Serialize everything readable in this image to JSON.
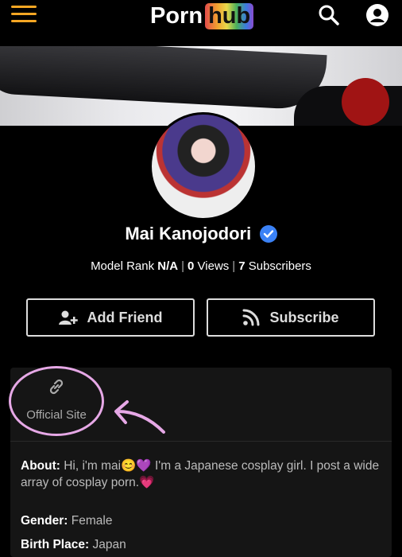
{
  "header": {
    "logo_porn": "Porn",
    "logo_hub": "hub"
  },
  "icons": {
    "menu": "hamburger-icon",
    "search": "search-icon",
    "account": "account-icon",
    "verified": "verified-badge-icon",
    "add_friend": "add-user-icon",
    "subscribe": "rss-icon",
    "link": "link-icon"
  },
  "colors": {
    "accent": "#f5a623",
    "verified": "#3b82f6",
    "annotation": "#e6a8e6"
  },
  "profile": {
    "name": "Mai Kanojodori",
    "rank_label": "Model Rank",
    "rank_value": "N/A",
    "views_value": "0",
    "views_label": "Views",
    "subs_value": "7",
    "subs_label": "Subscribers"
  },
  "actions": {
    "add_friend": "Add Friend",
    "subscribe": "Subscribe"
  },
  "info": {
    "official_site": "Official Site",
    "about_label": "About:",
    "about_text": "Hi, i'm mai😊💜 I'm a Japanese cosplay girl. I post a wide array of cosplay porn.💗",
    "gender_label": "Gender:",
    "gender_value": "Female",
    "birth_label": "Birth Place:",
    "birth_value": "Japan"
  }
}
